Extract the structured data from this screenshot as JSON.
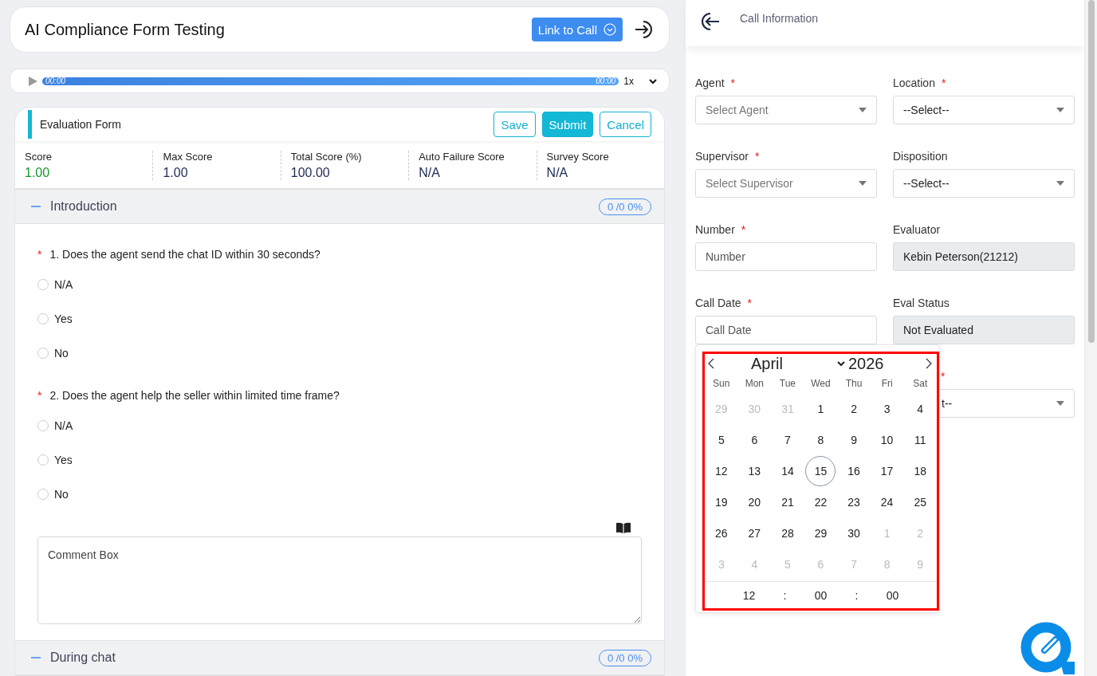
{
  "header": {
    "title": "AI Compliance Form Testing",
    "link_button": "Link to Call"
  },
  "player": {
    "current_time": "00:00",
    "total_time": "00:00",
    "speed": "1x",
    "level": 1
  },
  "form": {
    "title": "Evaluation Form",
    "buttons": [
      {
        "label": "Save",
        "kind": "outline"
      },
      {
        "label": "Submit",
        "kind": "filled"
      },
      {
        "label": "Cancel",
        "kind": "outline"
      }
    ],
    "scores": [
      {
        "label": "Score",
        "value": "1.00",
        "kind": "good"
      },
      {
        "label": "Max Score",
        "value": "1.00",
        "kind": "plain"
      },
      {
        "label": "Total Score (%)",
        "value": "100.00",
        "kind": "plain"
      },
      {
        "label": "Auto Failure Score",
        "value": "N/A",
        "kind": "plain"
      },
      {
        "label": "Survey Score",
        "value": "N/A",
        "kind": "plain"
      }
    ],
    "sections": [
      {
        "title": "Introduction",
        "badge": "0 /0 0%",
        "expanded": true,
        "questions": [
          {
            "text": "1. Does the agent send the chat ID within 30 seconds?",
            "required_mark": "*",
            "options": [
              {
                "label": "N/A",
                "selected": false
              },
              {
                "label": "Yes",
                "selected": false
              },
              {
                "label": "No",
                "selected": false
              }
            ]
          },
          {
            "text": "2. Does the agent help the seller within limited time frame?",
            "required_mark": "*",
            "options": [
              {
                "label": "N/A",
                "selected": false
              },
              {
                "label": "Yes",
                "selected": false
              },
              {
                "label": "No",
                "selected": false
              }
            ]
          }
        ],
        "comment_placeholder": "Comment Box"
      },
      {
        "title": "During chat",
        "badge": "0 /0 0%",
        "expanded": true
      }
    ]
  },
  "call_info": {
    "title": "Call Information",
    "fields": [
      {
        "label": "Agent",
        "required_mark": "*",
        "kind": "select",
        "placeholder": "Select Agent"
      },
      {
        "label": "Location",
        "required_mark": "*",
        "kind": "select",
        "value": "--Select--"
      },
      {
        "label": "Supervisor",
        "required_mark": "*",
        "kind": "select",
        "placeholder": "Select Supervisor"
      },
      {
        "label": "Disposition",
        "kind": "select",
        "value": "--Select--"
      },
      {
        "label": "Number",
        "required_mark": "*",
        "kind": "input",
        "placeholder": "Number"
      },
      {
        "label": "Evaluator",
        "kind": "readonly",
        "value": "Kebin Peterson(21212)"
      },
      {
        "label": "Call Date",
        "required_mark": "*",
        "kind": "input",
        "placeholder": "Call Date"
      },
      {
        "label": "Eval Status",
        "kind": "readonly",
        "value": "Not Evaluated"
      },
      {
        "required_mark": "*",
        "kind": "covered-select",
        "value": "t--"
      }
    ]
  },
  "calendar": {
    "month": "April",
    "year": "2026",
    "weekdays": [
      "Sun",
      "Mon",
      "Tue",
      "Wed",
      "Thu",
      "Fri",
      "Sat"
    ],
    "days": [
      {
        "label": "29",
        "outside": true,
        "today": false
      },
      {
        "label": "30",
        "outside": true,
        "today": false
      },
      {
        "label": "31",
        "outside": true,
        "today": false
      },
      {
        "label": "1",
        "outside": false,
        "today": false
      },
      {
        "label": "2",
        "outside": false,
        "today": false
      },
      {
        "label": "3",
        "outside": false,
        "today": false
      },
      {
        "label": "4",
        "outside": false,
        "today": false
      },
      {
        "label": "5",
        "outside": false,
        "today": false
      },
      {
        "label": "6",
        "outside": false,
        "today": false
      },
      {
        "label": "7",
        "outside": false,
        "today": false
      },
      {
        "label": "8",
        "outside": false,
        "today": false
      },
      {
        "label": "9",
        "outside": false,
        "today": false
      },
      {
        "label": "10",
        "outside": false,
        "today": false
      },
      {
        "label": "11",
        "outside": false,
        "today": false
      },
      {
        "label": "12",
        "outside": false,
        "today": false
      },
      {
        "label": "13",
        "outside": false,
        "today": false
      },
      {
        "label": "14",
        "outside": false,
        "today": false
      },
      {
        "label": "15",
        "outside": false,
        "today": true
      },
      {
        "label": "16",
        "outside": false,
        "today": false
      },
      {
        "label": "17",
        "outside": false,
        "today": false
      },
      {
        "label": "18",
        "outside": false,
        "today": false
      },
      {
        "label": "19",
        "outside": false,
        "today": false
      },
      {
        "label": "20",
        "outside": false,
        "today": false
      },
      {
        "label": "21",
        "outside": false,
        "today": false
      },
      {
        "label": "22",
        "outside": false,
        "today": false
      },
      {
        "label": "23",
        "outside": false,
        "today": false
      },
      {
        "label": "24",
        "outside": false,
        "today": false
      },
      {
        "label": "25",
        "outside": false,
        "today": false
      },
      {
        "label": "26",
        "outside": false,
        "today": false
      },
      {
        "label": "27",
        "outside": false,
        "today": false
      },
      {
        "label": "28",
        "outside": false,
        "today": false
      },
      {
        "label": "29",
        "outside": false,
        "today": false
      },
      {
        "label": "30",
        "outside": false,
        "today": false
      },
      {
        "label": "1",
        "outside": true,
        "today": false
      },
      {
        "label": "2",
        "outside": true,
        "today": false
      },
      {
        "label": "3",
        "outside": true,
        "today": false
      },
      {
        "label": "4",
        "outside": true,
        "today": false
      },
      {
        "label": "5",
        "outside": true,
        "today": false
      },
      {
        "label": "6",
        "outside": true,
        "today": false
      },
      {
        "label": "7",
        "outside": true,
        "today": false
      },
      {
        "label": "8",
        "outside": true,
        "today": false
      },
      {
        "label": "9",
        "outside": true,
        "today": false
      }
    ],
    "time": [
      "12",
      ":",
      "00",
      ":",
      "00"
    ],
    "highlighted": true
  }
}
